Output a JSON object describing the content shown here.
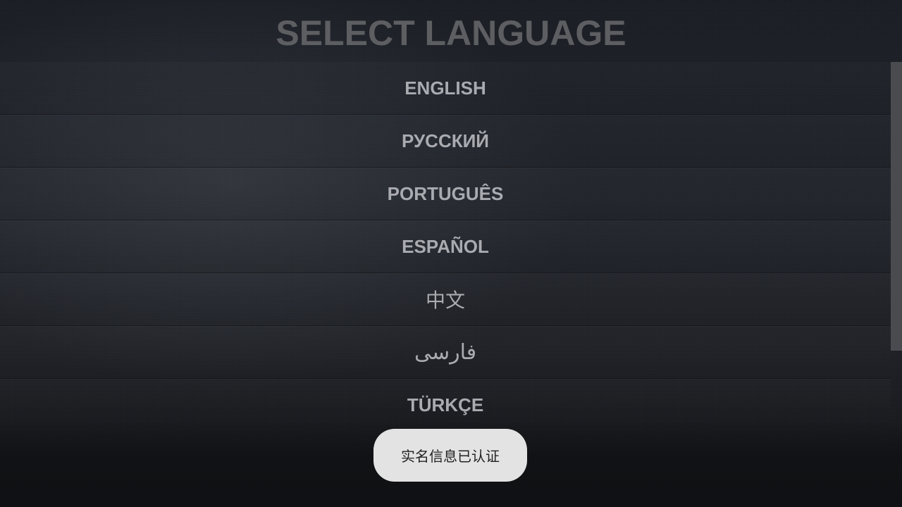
{
  "header": {
    "title": "SELECT LANGUAGE"
  },
  "languages": [
    {
      "label": "ENGLISH"
    },
    {
      "label": "РУССКИЙ"
    },
    {
      "label": "PORTUGUÊS"
    },
    {
      "label": "ESPAÑOL"
    },
    {
      "label": "中文"
    },
    {
      "label": "فارسی"
    },
    {
      "label": "TÜRKÇE"
    }
  ],
  "toast": {
    "message": "实名信息已认证"
  },
  "colors": {
    "title": "#5d5e61",
    "item_text": "#a9abb0",
    "toast_bg": "#e3e3e3",
    "scrollbar": "#4a4b4e"
  }
}
